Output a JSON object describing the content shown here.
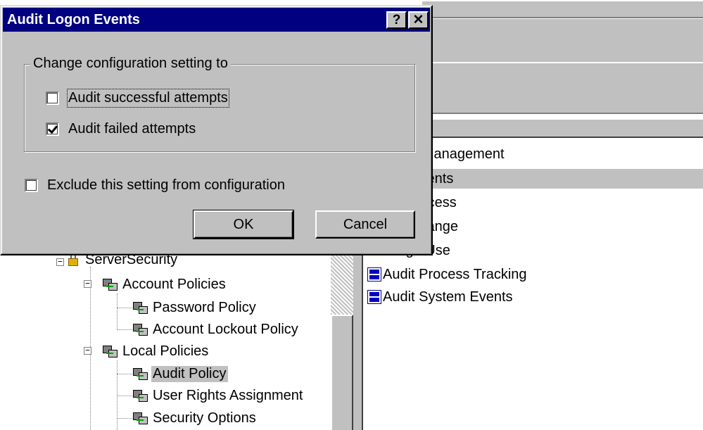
{
  "dialog": {
    "title": "Audit Logon Events",
    "help_glyph": "?",
    "close_glyph": "✕",
    "group_label": "Change configuration setting to",
    "success_option": {
      "label": "Audit successful attempts",
      "accel": "s",
      "checked": false
    },
    "failed_option": {
      "label": "Audit failed attempts",
      "accel": "f",
      "checked": true
    },
    "exclude_option": {
      "label": "Exclude this setting from configuration",
      "accel": "x",
      "checked": false
    },
    "ok_label": "OK",
    "cancel_label": "Cancel"
  },
  "policy_list": {
    "items": [
      {
        "label": "Account Management",
        "selected": false
      },
      {
        "label": "Logon Events",
        "selected": true
      },
      {
        "label": "Object Access",
        "selected": false
      },
      {
        "label": "Policy Change",
        "selected": false
      },
      {
        "label": "Privilege Use",
        "selected": false
      },
      {
        "label": "Audit Process Tracking",
        "selected": false
      },
      {
        "label": "Audit System Events",
        "selected": false
      }
    ]
  },
  "tree": {
    "root": "ServerSecurity",
    "account_policies": "Account Policies",
    "password_policy": "Password Policy",
    "lockout_policy": "Account Lockout Policy",
    "local_policies": "Local Policies",
    "audit_policy": "Audit Policy",
    "user_rights": "User Rights Assignment",
    "security_options": "Security Options",
    "collapse_glyph": "−"
  },
  "colors": {
    "titlebar": "#000080",
    "face": "#c0c0c0",
    "selection": "#c0c0c0"
  }
}
